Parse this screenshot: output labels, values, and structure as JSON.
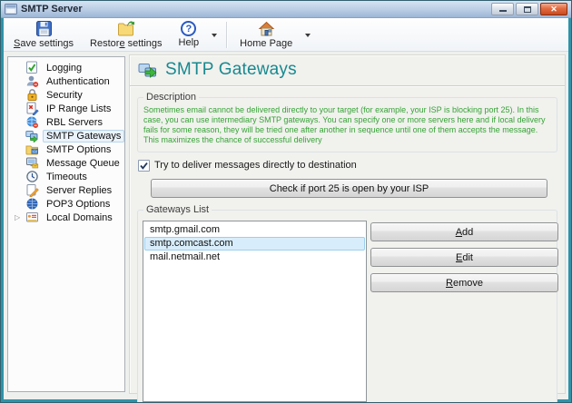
{
  "window": {
    "title": "SMTP Server",
    "buttons": [
      "minimize",
      "maximize",
      "close"
    ]
  },
  "toolbar": {
    "items": [
      {
        "label": "Save settings",
        "mnemonic_index": 0,
        "icon": "floppy-save-icon",
        "has_dropdown": false
      },
      {
        "label": "Restore settings",
        "mnemonic_index": 6,
        "icon": "restore-folder-icon",
        "has_dropdown": false
      },
      {
        "label": "Help",
        "mnemonic_index": -1,
        "icon": "help-icon",
        "has_dropdown": true
      },
      {
        "label": "Home Page",
        "mnemonic_index": -1,
        "icon": "home-icon",
        "has_dropdown": true
      }
    ]
  },
  "sidebar": {
    "items": [
      {
        "label": "Logging",
        "icon": "logging-icon",
        "selected": false
      },
      {
        "label": "Authentication",
        "icon": "authentication-icon",
        "selected": false
      },
      {
        "label": "Security",
        "icon": "security-icon",
        "selected": false
      },
      {
        "label": "IP Range Lists",
        "icon": "ip-range-lists-icon",
        "selected": false
      },
      {
        "label": "RBL Servers",
        "icon": "rbl-servers-icon",
        "selected": false
      },
      {
        "label": "SMTP Gateways",
        "icon": "smtp-gateways-icon",
        "selected": true
      },
      {
        "label": "SMTP Options",
        "icon": "smtp-options-icon",
        "selected": false
      },
      {
        "label": "Message Queue",
        "icon": "message-queue-icon",
        "selected": false
      },
      {
        "label": "Timeouts",
        "icon": "timeouts-icon",
        "selected": false
      },
      {
        "label": "Server Replies",
        "icon": "server-replies-icon",
        "selected": false
      },
      {
        "label": "POP3 Options",
        "icon": "pop3-options-icon",
        "selected": false
      },
      {
        "label": "Local Domains",
        "icon": "local-domains-icon",
        "selected": false,
        "expandable": true
      }
    ]
  },
  "main": {
    "heading": "SMTP Gateways",
    "description": {
      "label": "Description",
      "text": "Sometimes email cannot be delivered directly to your target (for example, your ISP is blocking port 25). In this case, you can use intermediary SMTP gateways. You can specify one or more servers here and if local delivery fails for some reason, they will be tried one after another in sequence until one of them accepts the message. This maximizes the chance of successful delivery"
    },
    "deliver_checkbox": {
      "label": "Try to deliver messages directly to destination",
      "checked": true
    },
    "check_port_button": {
      "label": "Check if port 25 is open by your ISP",
      "mnemonic_index": -1
    },
    "gateways": {
      "label": "Gateways List",
      "items": [
        "smtp.gmail.com",
        "smtp.comcast.com",
        "mail.netmail.net"
      ],
      "selected_index": 1,
      "buttons": [
        {
          "label": "Add",
          "mnemonic_index": 0
        },
        {
          "label": "Edit",
          "mnemonic_index": 0
        },
        {
          "label": "Remove",
          "mnemonic_index": 0
        }
      ]
    }
  },
  "colors": {
    "heading_teal": "#17898f",
    "description_green": "#35a435",
    "frame_teal": "#2e93a8",
    "selection_blue": "#d8edfb",
    "titlebar_blue": "#bccfe6"
  }
}
